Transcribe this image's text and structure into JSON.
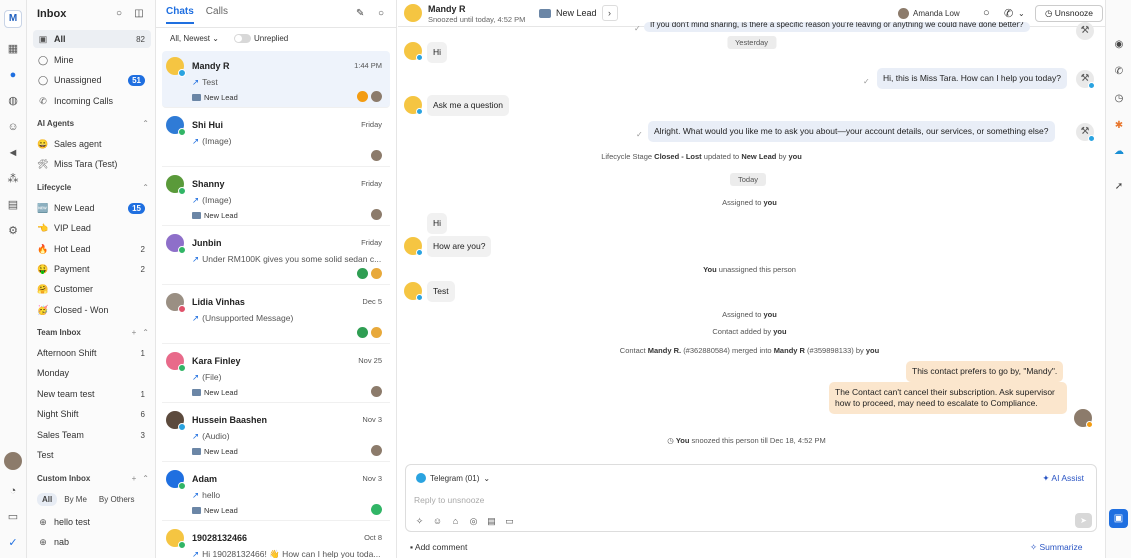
{
  "rail": {
    "logo": "M",
    "icons": [
      "grid-icon",
      "chat-icon",
      "contacts-icon",
      "broadcast-icon",
      "megaphone-icon",
      "workflow-icon",
      "reports-icon",
      "settings-icon",
      "bell-icon",
      "help-icon",
      "check-icon"
    ]
  },
  "inbox": {
    "title": "Inbox",
    "items": [
      {
        "label": "All",
        "count": "82",
        "icon": "▣"
      },
      {
        "label": "Mine",
        "count": "",
        "icon": "◯"
      },
      {
        "label": "Unassigned",
        "count": "51",
        "icon": "◯"
      },
      {
        "label": "Incoming Calls",
        "count": "",
        "icon": "✆"
      }
    ],
    "ai_section": "AI Agents",
    "ai_items": [
      {
        "label": "Sales agent",
        "icon": "😀"
      },
      {
        "label": "Miss Tara (Test)",
        "icon": "🛠"
      }
    ],
    "lifecycle_section": "Lifecycle",
    "lifecycle_items": [
      {
        "label": "New Lead",
        "count": "15",
        "icon": "🆕"
      },
      {
        "label": "VIP Lead",
        "count": "",
        "icon": "👈"
      },
      {
        "label": "Hot Lead",
        "count": "2",
        "icon": "🔥"
      },
      {
        "label": "Payment",
        "count": "2",
        "icon": "🤑"
      },
      {
        "label": "Customer",
        "count": "",
        "icon": "🤗"
      },
      {
        "label": "Closed - Won",
        "count": "",
        "icon": "🥳"
      }
    ],
    "team_section": "Team Inbox",
    "team_items": [
      {
        "label": "Afternoon Shift",
        "count": "1"
      },
      {
        "label": "Monday",
        "count": ""
      },
      {
        "label": "New team test",
        "count": "1"
      },
      {
        "label": "Night Shift",
        "count": "6"
      },
      {
        "label": "Sales Team",
        "count": "3"
      },
      {
        "label": "Test",
        "count": ""
      }
    ],
    "custom_section": "Custom Inbox",
    "segments": [
      "All",
      "By Me",
      "By Others"
    ],
    "custom_items": [
      {
        "label": "hello test"
      },
      {
        "label": "nab"
      }
    ]
  },
  "list": {
    "tabs": [
      "Chats",
      "Calls"
    ],
    "filter": "All, Newest",
    "unreplied": "Unreplied",
    "rows": [
      {
        "name": "Mandy R",
        "time": "1:44 PM",
        "preview": "Test",
        "tag": "New Lead",
        "av": "#f5c542",
        "badge": "#2aa3e0"
      },
      {
        "name": "Shi Hui",
        "time": "Friday",
        "preview": "(Image)",
        "tag": "",
        "av": "#2f7bd6",
        "badge": "#31b566"
      },
      {
        "name": "Shanny",
        "time": "Friday",
        "preview": "(Image)",
        "tag": "New Lead",
        "av": "#5a9a3a",
        "badge": "#31b566"
      },
      {
        "name": "Junbin",
        "time": "Friday",
        "preview": "Under RM100K gives you some solid sedan c...",
        "tag": "",
        "av": "#8e6fc9",
        "badge": "#31b566"
      },
      {
        "name": "Lidia Vinhas",
        "time": "Dec 5",
        "preview": "(Unsupported Message)",
        "tag": "",
        "av": "#9a8f83",
        "badge": "#e0526a"
      },
      {
        "name": "Kara Finley",
        "time": "Nov 25",
        "preview": "(File)",
        "tag": "New Lead",
        "av": "#e86a8a",
        "badge": "#31b566"
      },
      {
        "name": "Hussein Baashen",
        "time": "Nov 3",
        "preview": "(Audio)",
        "tag": "New Lead",
        "av": "#5c4a3d",
        "badge": "#2aa3e0"
      },
      {
        "name": "Adam",
        "time": "Nov 3",
        "preview": "hello",
        "tag": "New Lead",
        "av": "#1f6fe0",
        "badge": "#31b566"
      },
      {
        "name": "19028132466",
        "time": "Oct 8",
        "preview": "Hi 19028132466! 👋 How can I help you toda...",
        "tag": "",
        "av": "#f5c542",
        "badge": "#31b566"
      }
    ]
  },
  "conv": {
    "name": "Mandy R",
    "status": "Snoozed until today, 4:52 PM",
    "lifecycle": "New Lead",
    "agent": "Amanda Low",
    "snooze_btn": "Unsnooze",
    "top_cut": "If you don't mind sharing, is there a specific reason you're leaving or anything we could have done better?",
    "day1": "Yesterday",
    "m1": "Hi",
    "m2": "Hi, this is Miss Tara. How can I help you today?",
    "m3": "Ask me a question",
    "m4": "Alright. What would you like me to ask you about—your account details, our services, or something else?",
    "sys1_pre": "Lifecycle Stage",
    "sys1_stage": "Closed - Lost",
    "sys1_mid": "updated to",
    "sys1_new": "New Lead",
    "sys1_by": "by",
    "sys1_you": "you",
    "day2": "Today",
    "sys2_pre": "Assigned to",
    "sys2_you": "you",
    "m5": "Hi",
    "m6": "How are you?",
    "sys3_you": "You",
    "sys3_post": "unassigned this person",
    "m7": "Test",
    "sys4_pre": "Assigned to",
    "sys4_you": "you",
    "sys5_pre": "Contact added by",
    "sys5_you": "you",
    "sys6_a": "Contact",
    "sys6_b": "Mandy R.",
    "sys6_c": "(#362880584) merged into",
    "sys6_d": "Mandy R",
    "sys6_e": "(#359898133) by",
    "sys6_f": "you",
    "note1": "This contact prefers to go by, \"Mandy\".",
    "note2": "The Contact can't cancel their subscription. Ask supervisor how to proceed, may need to escalate to Compliance.",
    "sys7_you": "You",
    "sys7_post": "snoozed this person till Dec 18, 4:52 PM",
    "channel": "Telegram (01)",
    "ai_assist": "AI Assist",
    "placeholder": "Reply to unsnooze",
    "add_comment": "Add comment",
    "summarize": "Summarize"
  }
}
